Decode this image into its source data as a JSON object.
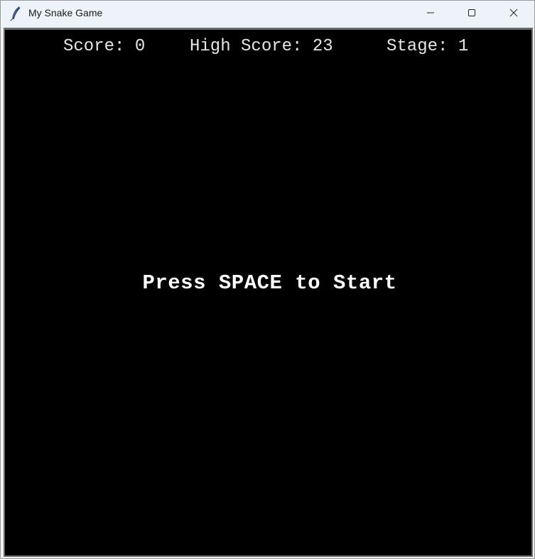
{
  "window": {
    "title": "My Snake Game",
    "icon": "feather-icon",
    "controls": {
      "minimize_icon": "minimize-icon",
      "maximize_icon": "maximize-icon",
      "close_icon": "close-icon"
    }
  },
  "hud": {
    "score_label": "Score:",
    "score_value": "0",
    "high_score_label": "High Score:",
    "high_score_value": "23",
    "stage_label": "Stage:",
    "stage_value": "1"
  },
  "game": {
    "start_message": "Press SPACE to Start",
    "background_color": "#000000",
    "text_color": "#ffffff"
  }
}
